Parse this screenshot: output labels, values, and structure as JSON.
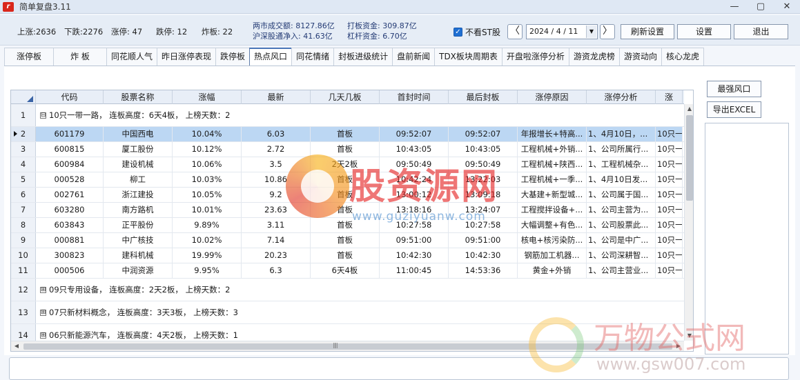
{
  "app": {
    "icon_text": "r",
    "title": "简单复盘3.11"
  },
  "window_controls": [
    "—",
    "▢",
    "✕"
  ],
  "stats": {
    "up": "上涨:2636",
    "down": "下跌:2276",
    "limit_up": "涨停: 47",
    "limit_down": "跌停: 12",
    "broken": "炸板: 22",
    "turnover": "两市成交额: 8127.86亿",
    "northbound": "沪深股通净入: 41.63亿",
    "board_funds": "打板资金: 309.87亿",
    "leverage_funds": "杠杆资金: 6.70亿"
  },
  "toolbar": {
    "hide_st_checked": "✓",
    "hide_st_label": "不看ST股",
    "prev": "〈",
    "next": "〉",
    "date": "2024 / 4 / 11",
    "date_dropdown": "▼",
    "refresh": "刷新设置",
    "settings": "设置",
    "exit": "退出"
  },
  "tabs": [
    "涨停板",
    "炸 板",
    "同花顺人气",
    "昨日涨停表现",
    "跌停板",
    "热点风口",
    "同花情绪",
    "封板进级统计",
    "盘前新闻",
    "TDX板块周期表",
    "开盘啦涨停分析",
    "游资龙虎榜",
    "游资动向",
    "核心龙虎"
  ],
  "active_tab": "热点风口",
  "table": {
    "headers": [
      "代码",
      "股票名称",
      "涨幅",
      "最新",
      "几天几板",
      "首封时间",
      "最后封板",
      "涨停原因",
      "涨停分析",
      "涨"
    ],
    "groups": [
      {
        "row": "1",
        "toggle": "⊟",
        "label": "10只一带一路， 连板高度：6天4板， 上榜天数：2"
      },
      {
        "row": "12",
        "toggle": "⊞",
        "label": "09只专用设备， 连板高度：2天2板， 上榜天数：2"
      },
      {
        "row": "13",
        "toggle": "⊞",
        "label": "07只新材料概念， 连板高度：3天3板， 上榜天数：3"
      },
      {
        "row": "14",
        "toggle": "⊞",
        "label": "06只新能源汽车， 连板高度：4天2板， 上榜天数：1"
      }
    ],
    "rows": [
      {
        "n": "2",
        "code": "601179",
        "name": "中国西电",
        "pct": "10.04%",
        "last": "6.03",
        "boards": "首板",
        "first": "09:52:07",
        "final": "09:52:07",
        "reason": "年报增长+特高...",
        "analysis": "1、4月10日，...",
        "extra": "10只一"
      },
      {
        "n": "3",
        "code": "600815",
        "name": "厦工股份",
        "pct": "10.12%",
        "last": "2.72",
        "boards": "首板",
        "first": "10:43:05",
        "final": "10:43:05",
        "reason": "工程机械+外销...",
        "analysis": "1、公司所属行...",
        "extra": "10只一"
      },
      {
        "n": "4",
        "code": "600984",
        "name": "建设机械",
        "pct": "10.06%",
        "last": "3.5",
        "boards": "2天2板",
        "first": "09:50:49",
        "final": "09:50:49",
        "reason": "工程机械+陕西...",
        "analysis": "1、工程机械杂...",
        "extra": "10只一"
      },
      {
        "n": "5",
        "code": "000528",
        "name": "柳工",
        "pct": "10.03%",
        "last": "10.86",
        "boards": "首板",
        "first": "10:42:24",
        "final": "13:22:03",
        "reason": "工程机械+一季...",
        "analysis": "1、4月10日发...",
        "extra": "10只一"
      },
      {
        "n": "6",
        "code": "002761",
        "name": "浙江建投",
        "pct": "10.05%",
        "last": "9.2",
        "boards": "首板",
        "first": "13:00:12",
        "final": "13:09:18",
        "reason": "大基建+新型城...",
        "analysis": "1、公司属于国...",
        "extra": "10只一"
      },
      {
        "n": "7",
        "code": "603280",
        "name": "南方路机",
        "pct": "10.01%",
        "last": "23.63",
        "boards": "首板",
        "first": "13:18:16",
        "final": "13:24:07",
        "reason": "工程搅拌设备+...",
        "analysis": "1、公司主营为...",
        "extra": "10只一"
      },
      {
        "n": "8",
        "code": "603843",
        "name": "正平股份",
        "pct": "9.89%",
        "last": "3.11",
        "boards": "首板",
        "first": "10:27:58",
        "final": "10:27:58",
        "reason": "大幅调整+有色...",
        "analysis": "1、公司股票此...",
        "extra": "10只一"
      },
      {
        "n": "9",
        "code": "000881",
        "name": "中广核技",
        "pct": "10.02%",
        "last": "7.14",
        "boards": "首板",
        "first": "09:51:00",
        "final": "09:51:00",
        "reason": "核电+核污染防...",
        "analysis": "1、公司是中广...",
        "extra": "10只一"
      },
      {
        "n": "10",
        "code": "300823",
        "name": "建科机械",
        "pct": "19.99%",
        "last": "20.23",
        "boards": "首板",
        "first": "10:42:30",
        "final": "10:42:30",
        "reason": "钢筋加工机器...",
        "analysis": "1、公司深耕智...",
        "extra": "10只一"
      },
      {
        "n": "11",
        "code": "000506",
        "name": "中润资源",
        "pct": "9.95%",
        "last": "6.3",
        "boards": "6天4板",
        "first": "11:00:45",
        "final": "14:53:36",
        "reason": "黄金+外销",
        "analysis": "1、公司主营业...",
        "extra": "10只一"
      }
    ],
    "selected_row": "2"
  },
  "scroll": {
    "up": "▲",
    "down": "▼",
    "left": "◀",
    "right": "▶",
    "grip": "||||"
  },
  "right_panel": {
    "strongest": "最强风口",
    "export": "导出EXCEL"
  },
  "watermarks": {
    "main_text": "股资源网",
    "main_url": "www.guziyuanw.com",
    "corner_text": "万物公式网",
    "corner_url": "www.gsw007.com"
  },
  "colors": {
    "selected_row": "#bcd7f3",
    "accent": "#1f6fd2",
    "active_tab_border": "#4a76b8"
  }
}
